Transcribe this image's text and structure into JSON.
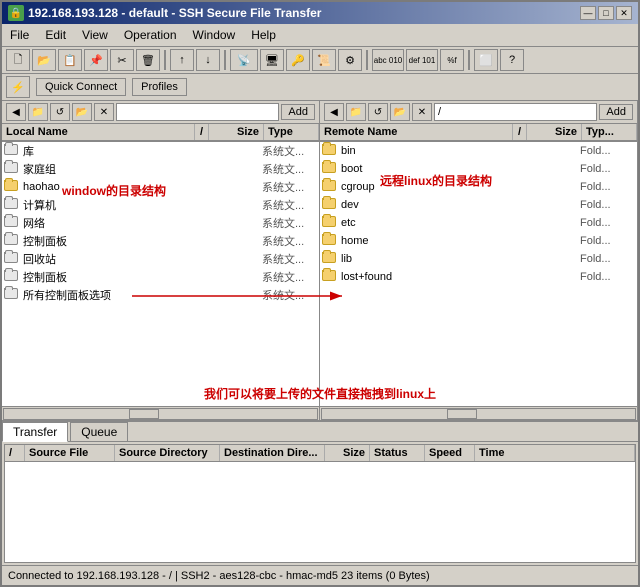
{
  "window": {
    "title": "192.168.193.128 - default - SSH Secure File Transfer",
    "icon": "🔒"
  },
  "titleButtons": {
    "minimize": "—",
    "maximize": "□",
    "close": "✕"
  },
  "menu": {
    "items": [
      "File",
      "Edit",
      "View",
      "Operation",
      "Window",
      "Help"
    ]
  },
  "nav": {
    "quickConnect": "Quick Connect",
    "profiles": "Profiles"
  },
  "localPanel": {
    "path": "",
    "addLabel": "Add",
    "columns": {
      "name": "Local Name",
      "slash": "/",
      "size": "Size",
      "type": "Type"
    },
    "files": [
      {
        "name": "库",
        "size": "",
        "type": "系统文..."
      },
      {
        "name": "家庭组",
        "size": "",
        "type": "系统文..."
      },
      {
        "name": "haohao",
        "size": "",
        "type": "系统文..."
      },
      {
        "name": "计算机",
        "size": "",
        "type": "系统文..."
      },
      {
        "name": "网络",
        "size": "",
        "type": "系统文..."
      },
      {
        "name": "控制面板",
        "size": "",
        "type": "系统文..."
      },
      {
        "name": "回收站",
        "size": "",
        "type": "系统文..."
      },
      {
        "name": "控制面板",
        "size": "",
        "type": "系统文..."
      },
      {
        "name": "所有控制面板选项",
        "size": "",
        "type": "系统文..."
      }
    ],
    "annotation": "window的目录结构"
  },
  "remotePanel": {
    "path": "/",
    "addLabel": "Add",
    "columns": {
      "name": "Remote Name",
      "slash": "/",
      "size": "Size",
      "type": "Typ..."
    },
    "files": [
      {
        "name": "bin",
        "size": "",
        "type": "Fold..."
      },
      {
        "name": "boot",
        "size": "",
        "type": "Fold..."
      },
      {
        "name": "cgroup",
        "size": "",
        "type": "Fold..."
      },
      {
        "name": "dev",
        "size": "",
        "type": "Fold..."
      },
      {
        "name": "etc",
        "size": "",
        "type": "Fold..."
      },
      {
        "name": "home",
        "size": "",
        "type": "Fold..."
      },
      {
        "name": "lib",
        "size": "",
        "type": "Fold..."
      },
      {
        "name": "lost+found",
        "size": "",
        "type": "Fold..."
      }
    ],
    "annotation": "远程linux的目录结构"
  },
  "bottomAnnotation": "我们可以将要上传的文件直接拖拽到linux上",
  "transfer": {
    "tabs": [
      "Transfer",
      "Queue"
    ],
    "activeTab": "Transfer",
    "columns": {
      "num": "/",
      "sourceFile": "Source File",
      "sourceDir": "Source Directory",
      "destDir": "Destination Dire...",
      "size": "Size",
      "status": "Status",
      "speed": "Speed",
      "time": "Time"
    }
  },
  "statusBar": {
    "text": "Connected to 192.168.193.128 - / | SSH2 - aes128-cbc - hmac-md5  23 items (0 Bytes)"
  }
}
